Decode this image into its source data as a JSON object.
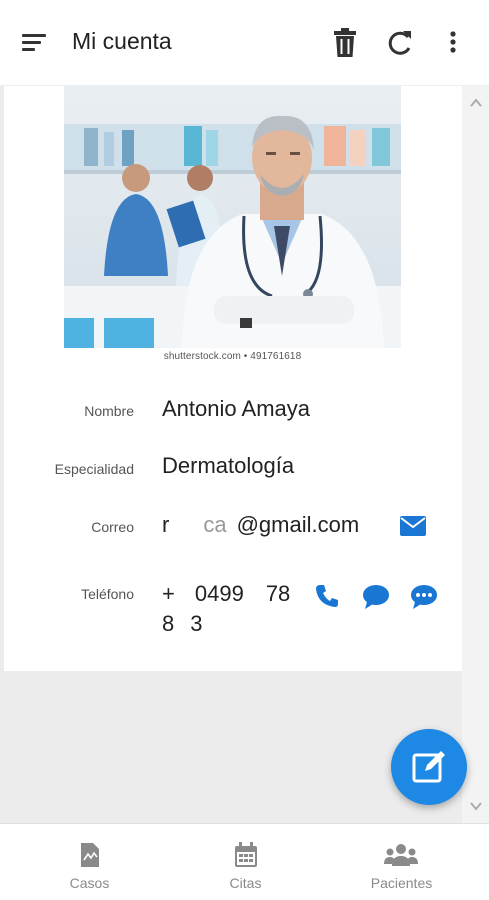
{
  "header": {
    "title": "Mi cuenta",
    "icons": [
      "menu-icon",
      "delete-icon",
      "refresh-icon",
      "more-vert-icon"
    ]
  },
  "photo": {
    "watermark": "shutterstock.com • 491761618"
  },
  "profile": {
    "fields": [
      {
        "label": "Nombre",
        "value": "Antonio Amaya"
      },
      {
        "label": "Especialidad",
        "value": "Dermatología"
      },
      {
        "label": "Correo",
        "value_prefix": "r",
        "value_middle": "ca",
        "value_suffix": "@gmail.com"
      },
      {
        "label": "Teléfono",
        "value_line1_a": "+",
        "value_line1_b": "0499",
        "value_line1_c": "78",
        "value_line2_a": "8",
        "value_line2_b": "3"
      }
    ]
  },
  "bottom_nav": {
    "items": [
      {
        "label": "Casos",
        "icon": "case-icon"
      },
      {
        "label": "Citas",
        "icon": "calendar-icon"
      },
      {
        "label": "Pacientes",
        "icon": "people-icon"
      }
    ]
  },
  "colors": {
    "accent": "#1e88e5",
    "action_blue": "#1976d2",
    "nav_gray": "#8a8a8a"
  }
}
